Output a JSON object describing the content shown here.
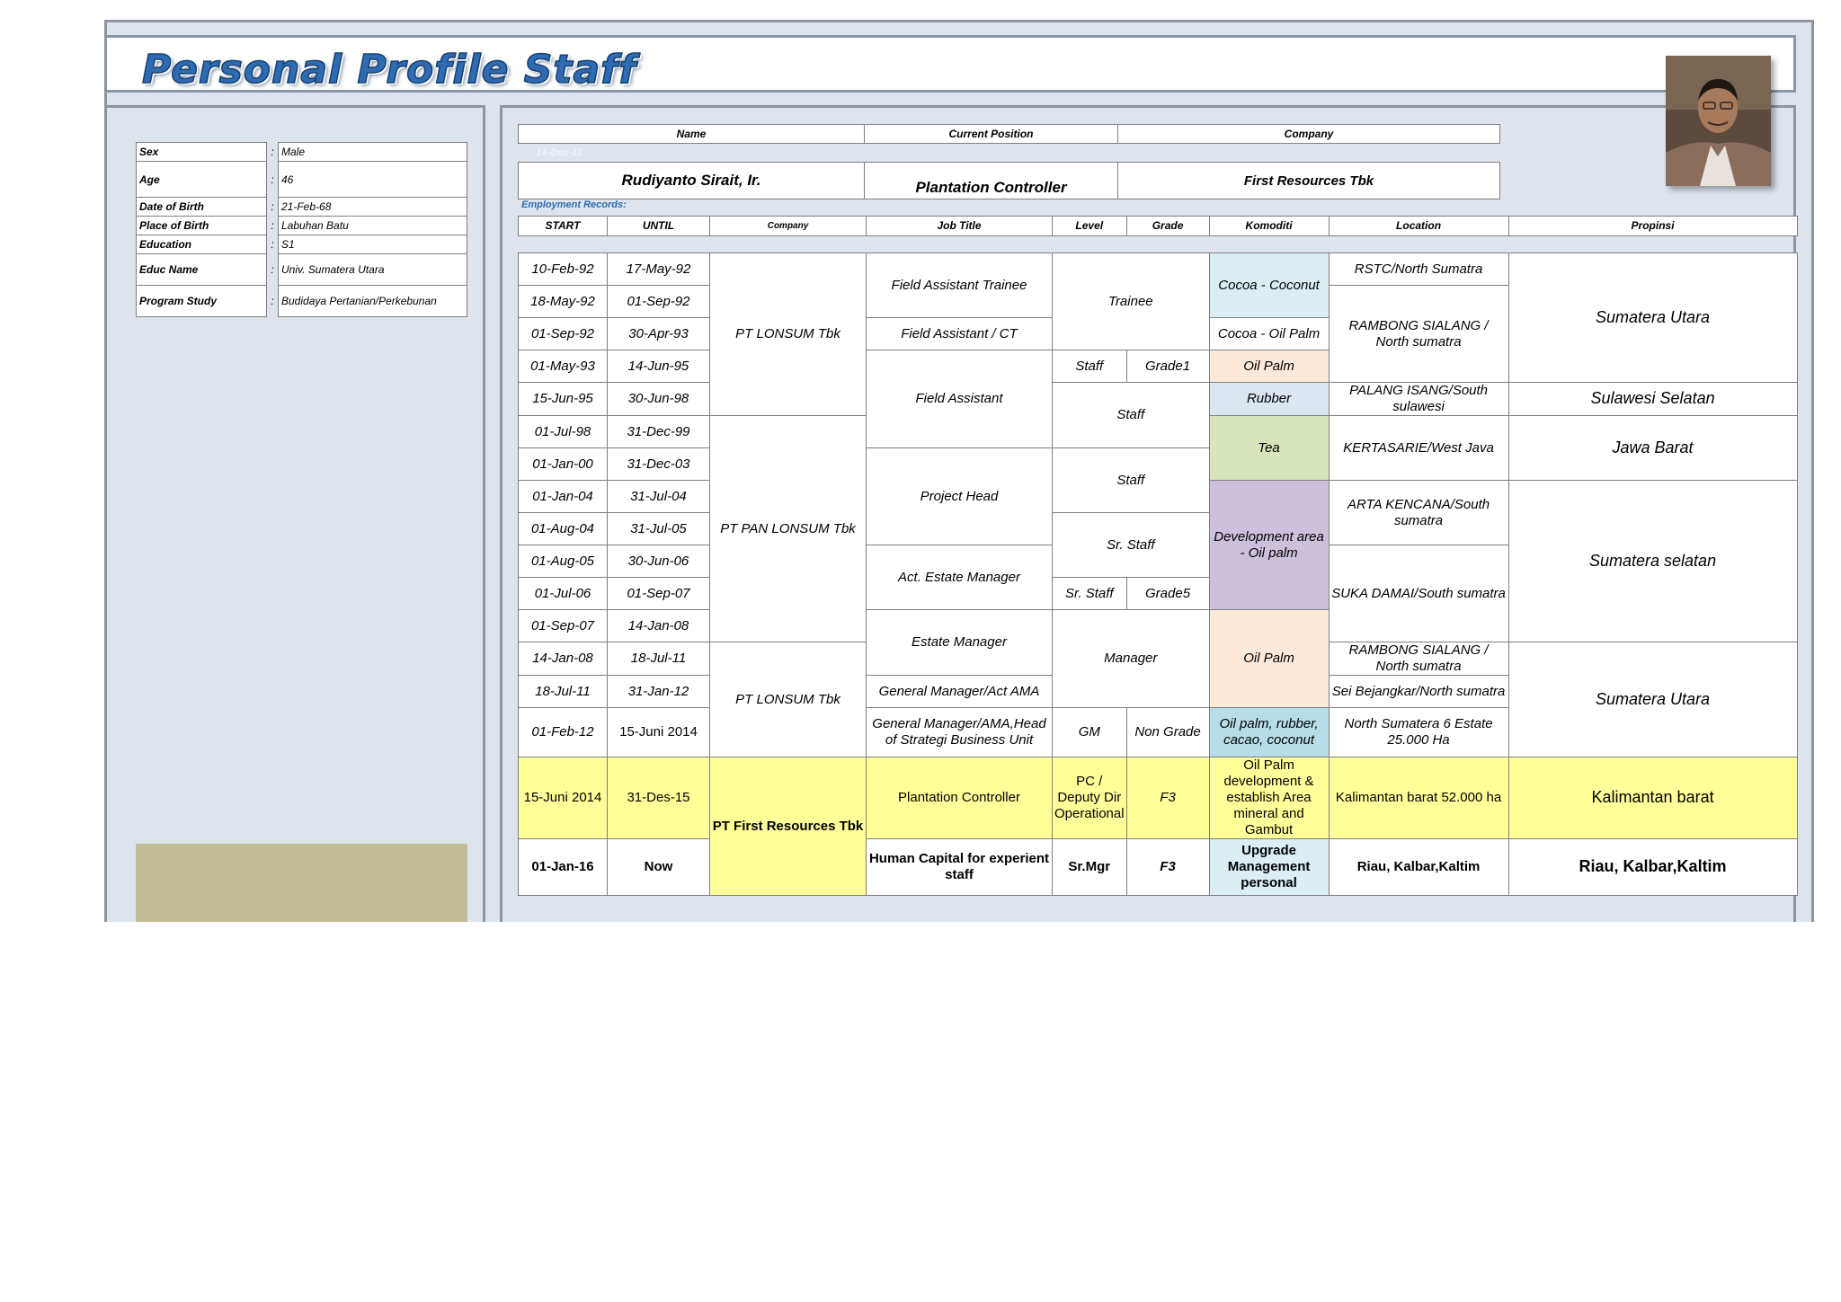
{
  "header": {
    "title": "Personal Profile Staff"
  },
  "profile": {
    "fields": [
      {
        "label": "Sex",
        "value": "Male"
      },
      {
        "label": "Age",
        "value": "46"
      },
      {
        "label": "Date of Birth",
        "value": "21-Feb-68"
      },
      {
        "label": "Place of Birth",
        "value": "Labuhan Batu"
      },
      {
        "label": "Education",
        "value": "S1"
      },
      {
        "label": "Educ Name",
        "value": "Univ. Sumatera Utara"
      },
      {
        "label": "Program Study",
        "value": "Budidaya Pertanian/Perkebunan"
      }
    ],
    "colon": ":"
  },
  "summary": {
    "name_header": "Name",
    "position_header": "Current Position",
    "company_header": "Company",
    "name": "Rudiyanto Sirait, Ir.",
    "position": "Plantation Controller",
    "company": "First Resources Tbk",
    "faint_date": "14-Dec-11"
  },
  "employment": {
    "label": "Employment Records:",
    "headers": [
      "START",
      "UNTIL",
      "Company",
      "Job Title",
      "Level",
      "Grade",
      "Komoditi",
      "Location",
      "Propinsi"
    ],
    "starts": [
      "10-Feb-92",
      "18-May-92",
      "01-Sep-92",
      "01-May-93",
      "15-Jun-95",
      "01-Jul-98",
      "01-Jan-00",
      "01-Jan-04",
      "01-Aug-04",
      "01-Aug-05",
      "01-Jul-06",
      "01-Sep-07",
      "14-Jan-08",
      "18-Jul-11",
      "01-Feb-12",
      "15-Juni 2014",
      "01-Jan-16"
    ],
    "untils": [
      "17-May-92",
      "01-Sep-92",
      "30-Apr-93",
      "14-Jun-95",
      "30-Jun-98",
      "31-Dec-99",
      "31-Dec-03",
      "31-Jul-04",
      "31-Jul-05",
      "30-Jun-06",
      "01-Sep-07",
      "14-Jan-08",
      "18-Jul-11",
      "31-Jan-12",
      "15-Juni 2014",
      "31-Des-15",
      "Now"
    ],
    "companies": [
      "PT LONSUM Tbk",
      "PT PAN LONSUM Tbk",
      "PT LONSUM Tbk",
      "PT First Resources Tbk"
    ],
    "jobs": [
      "Field Assistant Trainee",
      "Field Assistant / CT",
      "Field Assistant",
      "Project Head",
      "Act. Estate Manager",
      "Estate Manager",
      "General Manager/Act AMA",
      "General Manager/AMA,Head of Strategi Business Unit",
      "Plantation Controller",
      "Human Capital for experient staff"
    ],
    "levels": [
      "Trainee",
      "Staff",
      "Staff",
      "Staff",
      "Sr. Staff",
      "Sr. Staff",
      "Manager",
      "GM",
      "PC / Deputy Dir Operational",
      "Sr.Mgr"
    ],
    "grades": [
      "Grade1",
      "Grade5",
      "Non Grade",
      "F3",
      "F3"
    ],
    "komoditi": [
      "Cocoa - Coconut",
      "Cocoa - Oil Palm",
      "Oil Palm",
      "Rubber",
      "Tea",
      "Development area - Oil palm",
      "Oil Palm",
      "Oil palm, rubber, cacao, coconut",
      "Oil Palm development & establish Area mineral and Gambut",
      "Upgrade Management personal"
    ],
    "locations": [
      "RSTC/North Sumatra",
      "RAMBONG SIALANG / North sumatra",
      "PALANG ISANG/South sulawesi",
      "KERTASARIE/West Java",
      "ARTA KENCANA/South sumatra",
      "SUKA DAMAI/South sumatra",
      "RAMBONG SIALANG / North sumatra",
      "Sei Bejangkar/North sumatra",
      "North Sumatera 6 Estate 25.000 Ha",
      "Kalimantan barat 52.000 ha",
      "Riau, Kalbar,Kaltim"
    ],
    "propinsi": [
      "Sumatera Utara",
      "Sulawesi Selatan",
      "Jawa Barat",
      "Sumatera selatan",
      "Sumatera Utara",
      "Kalimantan barat",
      "Riau, Kalbar,Kaltim"
    ]
  },
  "colors": {
    "title_blue": "#2e6bb3",
    "border": "#8c96a3",
    "panel": "#dde4ee",
    "highlight_yellow": "#ffff99"
  }
}
